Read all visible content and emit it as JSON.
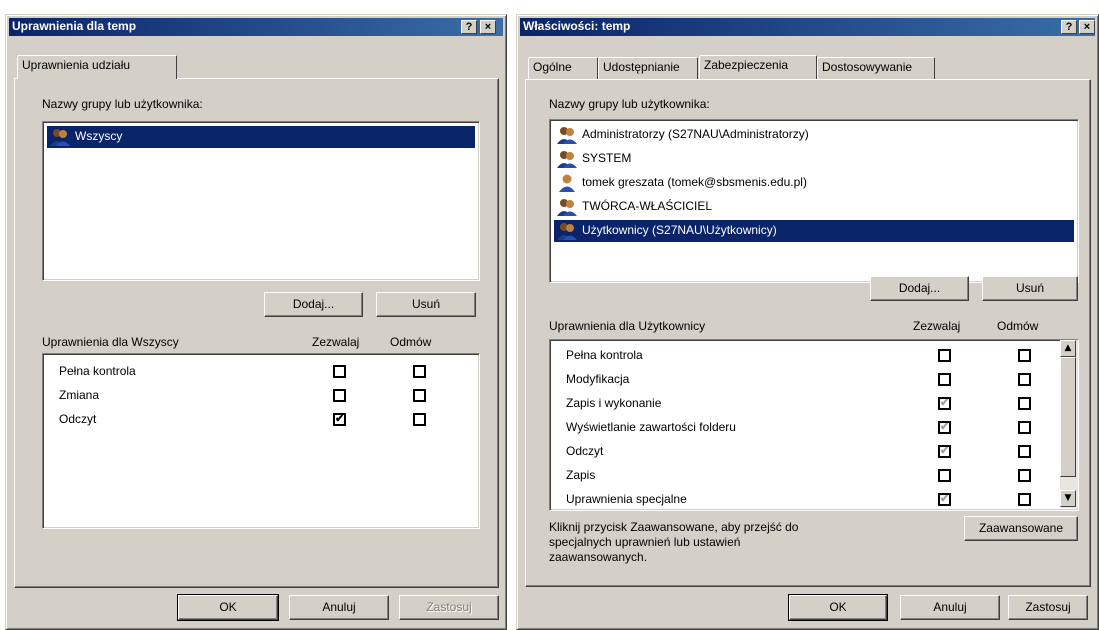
{
  "dialog1": {
    "title": "Uprawnienia dla temp",
    "help_label": "?",
    "close_label": "×",
    "tab": "Uprawnienia udziału",
    "group_label": "Nazwy grupy lub użytkownika:",
    "users": [
      {
        "name": "Wszyscy",
        "selected": true
      }
    ],
    "add_button": "Dodaj...",
    "remove_button": "Usuń",
    "perm_header": "Uprawnienia dla Wszyscy",
    "allow_header": "Zezwalaj",
    "deny_header": "Odmów",
    "permissions": [
      {
        "name": "Pełna kontrola",
        "allow": false,
        "deny": false
      },
      {
        "name": "Zmiana",
        "allow": false,
        "deny": false
      },
      {
        "name": "Odczyt",
        "allow": true,
        "deny": false
      }
    ],
    "ok_button": "OK",
    "cancel_button": "Anuluj",
    "apply_button": "Zastosuj"
  },
  "dialog2": {
    "title": "Właściwości: temp",
    "help_label": "?",
    "close_label": "×",
    "tabs": [
      "Ogólne",
      "Udostępnianie",
      "Zabezpieczenia",
      "Dostosowywanie"
    ],
    "active_tab": "Zabezpieczenia",
    "group_label": "Nazwy grupy lub użytkownika:",
    "users": [
      {
        "name": "Administratorzy (S27NAU\\Administratorzy)",
        "icon": "group-icon"
      },
      {
        "name": "SYSTEM",
        "icon": "group-icon"
      },
      {
        "name": "tomek greszata (tomek@sbsmenis.edu.pl)",
        "icon": "user-icon"
      },
      {
        "name": "TWÓRCA-WŁAŚCICIEL",
        "icon": "group-icon"
      },
      {
        "name": "Użytkownicy (S27NAU\\Użytkownicy)",
        "icon": "group-icon",
        "selected": true
      }
    ],
    "add_button": "Dodaj...",
    "remove_button": "Usuń",
    "perm_header": "Uprawnienia dla Użytkownicy",
    "allow_header": "Zezwalaj",
    "deny_header": "Odmów",
    "permissions": [
      {
        "name": "Pełna kontrola",
        "allow": "unchecked",
        "deny": "unchecked"
      },
      {
        "name": "Modyfikacja",
        "allow": "unchecked",
        "deny": "unchecked"
      },
      {
        "name": "Zapis i wykonanie",
        "allow": "grayed",
        "deny": "unchecked"
      },
      {
        "name": "Wyświetlanie zawartości folderu",
        "allow": "grayed",
        "deny": "unchecked"
      },
      {
        "name": "Odczyt",
        "allow": "grayed",
        "deny": "unchecked"
      },
      {
        "name": "Zapis",
        "allow": "unchecked",
        "deny": "unchecked"
      },
      {
        "name": "Uprawnienia specjalne",
        "allow": "grayed",
        "deny": "unchecked"
      }
    ],
    "advanced_text_line1": "Kliknij przycisk Zaawansowane, aby przejść do",
    "advanced_text_line2": "specjalnych uprawnień lub ustawień",
    "advanced_text_line3": "zaawansowanych.",
    "advanced_button": "Zaawansowane",
    "ok_button": "OK",
    "cancel_button": "Anuluj",
    "apply_button": "Zastosuj"
  },
  "colors": {
    "dialog_face": "#d4d0c8",
    "title_active": "#0a246a",
    "selection": "#0a246a"
  }
}
